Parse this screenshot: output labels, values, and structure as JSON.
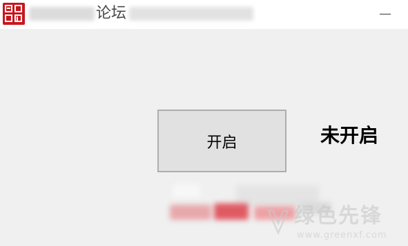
{
  "window": {
    "title_visible_fragment": "论坛"
  },
  "controls": {
    "toggle_button_label": "开启",
    "status_label": "未开启"
  },
  "watermark": {
    "title": "绿色先锋",
    "url": "www.greenxf.com"
  },
  "colors": {
    "window_background": "#f0f0f0",
    "button_background": "#e1e1e1",
    "button_border": "#adadad",
    "app_icon": "#c8161d"
  },
  "icons": {
    "app": "red-seal-icon",
    "minimize": "minimize-icon",
    "watermark": "green-leaf-logo-icon"
  }
}
